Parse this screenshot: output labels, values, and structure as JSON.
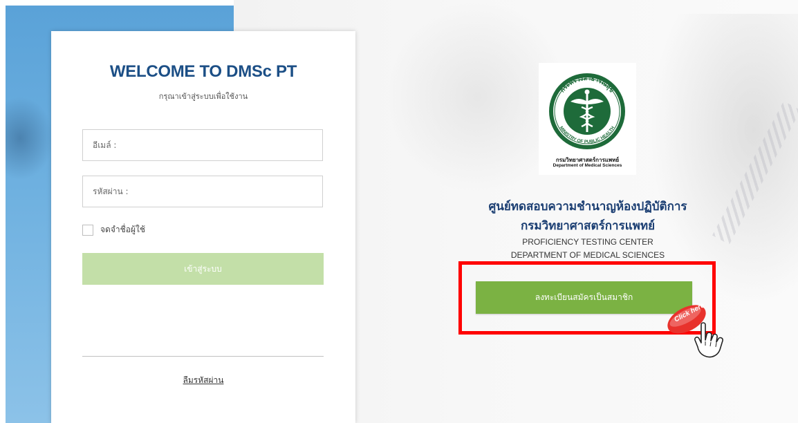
{
  "login": {
    "title": "WELCOME TO DMSc PT",
    "subtitle": "กรุณาเข้าสู่ระบบเพื่อใช้งาน",
    "email_placeholder": "อีเมล์ :",
    "password_placeholder": "รหัสผ่าน :",
    "remember_label": "จดจำชื่อผู้ใช้",
    "login_button": "เข้าสู่ระบบ",
    "forgot_password": "ลืมรหัสผ่าน"
  },
  "logo": {
    "ring_text": "กระทรวงสาธารณสุข",
    "ring_text_en": "MINISTRY OF PUBLIC HEALTH",
    "dept_th": "กรมวิทยาศาสตร์การแพทย์",
    "dept_en": "Department of Medical Sciences",
    "icon": "caduceus-seal-icon"
  },
  "center": {
    "title_th_line1": "ศูนย์ทดสอบความชำนาญห้องปฏิบัติการ",
    "title_th_line2": "กรมวิทยาศาสตร์การแพทย์",
    "title_en_line1": "PROFICIENCY TESTING CENTER",
    "title_en_line2": "DEPARTMENT OF MEDICAL SCIENCES"
  },
  "register": {
    "button_label": "ลงทะเบียนสมัครเป็นสมาชิก",
    "click_badge": "Click here",
    "pointer_icon": "hand-pointer-icon"
  },
  "colors": {
    "title_blue": "#1c4f86",
    "center_title_blue": "#1c3f73",
    "login_button_green": "#c3dfa8",
    "register_button_green": "#7bb243",
    "highlight_red": "#ff0000",
    "logo_green": "#1e6b3a",
    "badge_red": "#e8322c"
  }
}
